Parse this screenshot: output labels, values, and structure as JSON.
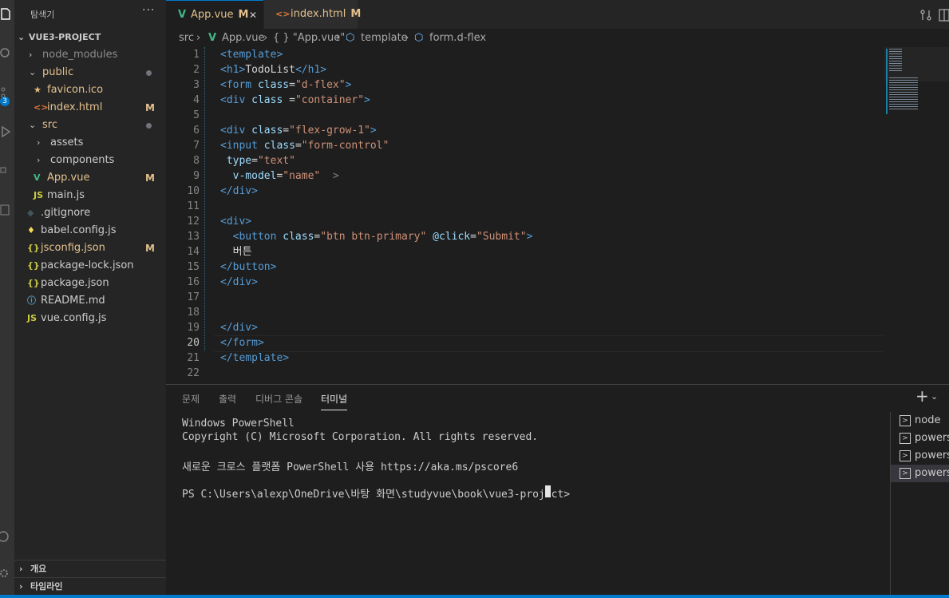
{
  "sidebar": {
    "title": "탐색기",
    "more": "···",
    "project": "VUE3-PROJECT",
    "items": [
      {
        "label": "node_modules",
        "type": "folder",
        "state": "collapsed",
        "color": "#8c8c8c"
      },
      {
        "label": "public",
        "type": "folder",
        "state": "expanded",
        "color": "#e2c08d",
        "dot": true
      },
      {
        "label": "favicon.ico",
        "type": "file",
        "icon": "★",
        "iconColor": "#e5c07b",
        "color": "#e2c08d"
      },
      {
        "label": "index.html",
        "type": "file",
        "icon": "<>",
        "iconColor": "#e37933",
        "color": "#e2c08d",
        "badge": "M"
      },
      {
        "label": "src",
        "type": "folder",
        "state": "expanded",
        "color": "#e2c08d",
        "dot": true
      },
      {
        "label": "assets",
        "type": "folder",
        "state": "collapsed",
        "color": "#cccccc"
      },
      {
        "label": "components",
        "type": "folder",
        "state": "collapsed",
        "color": "#cccccc"
      },
      {
        "label": "App.vue",
        "type": "file",
        "icon": "V",
        "iconColor": "#41b883",
        "color": "#e2c08d",
        "badge": "M"
      },
      {
        "label": "main.js",
        "type": "file",
        "icon": "JS",
        "iconColor": "#cbcb41",
        "color": "#cccccc"
      },
      {
        "label": ".gitignore",
        "type": "file",
        "icon": "◆",
        "iconColor": "#41535b",
        "color": "#cccccc"
      },
      {
        "label": "babel.config.js",
        "type": "file",
        "icon": "♦",
        "iconColor": "#f5da55",
        "color": "#cccccc"
      },
      {
        "label": "jsconfig.json",
        "type": "file",
        "icon": "{}",
        "iconColor": "#cbcb41",
        "color": "#e2c08d",
        "badge": "M"
      },
      {
        "label": "package-lock.json",
        "type": "file",
        "icon": "{}",
        "iconColor": "#cbcb41",
        "color": "#cccccc"
      },
      {
        "label": "package.json",
        "type": "file",
        "icon": "{}",
        "iconColor": "#cbcb41",
        "color": "#cccccc"
      },
      {
        "label": "README.md",
        "type": "file",
        "icon": "ⓘ",
        "iconColor": "#519aba",
        "color": "#cccccc"
      },
      {
        "label": "vue.config.js",
        "type": "file",
        "icon": "JS",
        "iconColor": "#cbcb41",
        "color": "#cccccc"
      }
    ],
    "outline_label": "개요",
    "timeline_label": "타임라인"
  },
  "activity": {
    "badge": "3"
  },
  "tabs": [
    {
      "label": "App.vue",
      "modified": "M",
      "active": true,
      "close": "✕",
      "icon": "V",
      "iconColor": "#41b883"
    },
    {
      "label": "index.html",
      "modified": "M",
      "active": false,
      "icon": "<>",
      "iconColor": "#e37933"
    }
  ],
  "breadcrumb": [
    "src",
    "App.vue",
    "{ } \"App.vue\"",
    "template",
    "form.d-flex"
  ],
  "editor": {
    "current_line": 20,
    "lines": [
      [
        [
          "t",
          "<template>"
        ]
      ],
      [
        [
          "t",
          "<h1>"
        ],
        [
          "w",
          "TodoList"
        ],
        [
          "t",
          "</h1>"
        ]
      ],
      [
        [
          "t",
          "<form "
        ],
        [
          "a",
          "class"
        ],
        [
          "w",
          "="
        ],
        [
          "s",
          "\"d-flex\""
        ],
        [
          "t",
          ">"
        ]
      ],
      [
        [
          "t",
          "<div "
        ],
        [
          "a",
          "class"
        ],
        [
          "w",
          " ="
        ],
        [
          "s",
          "\"container\""
        ],
        [
          "t",
          ">"
        ]
      ],
      [],
      [
        [
          "t",
          "<div "
        ],
        [
          "a",
          "class"
        ],
        [
          "w",
          "="
        ],
        [
          "s",
          "\"flex-grow-1\""
        ],
        [
          "t",
          ">"
        ]
      ],
      [
        [
          "t",
          "<input "
        ],
        [
          "a",
          "class"
        ],
        [
          "w",
          "="
        ],
        [
          "s",
          "\"form-control\""
        ]
      ],
      [
        [
          "w",
          " "
        ],
        [
          "a",
          "type"
        ],
        [
          "w",
          "="
        ],
        [
          "s",
          "\"text\""
        ]
      ],
      [
        [
          "w",
          "  "
        ],
        [
          "a",
          "v-model"
        ],
        [
          "w",
          "="
        ],
        [
          "s",
          "\"name\""
        ],
        [
          "w",
          "  "
        ],
        [
          "p",
          ">"
        ]
      ],
      [
        [
          "t",
          "</div>"
        ]
      ],
      [],
      [
        [
          "t",
          "<div>"
        ]
      ],
      [
        [
          "w",
          "  "
        ],
        [
          "t",
          "<button "
        ],
        [
          "a",
          "class"
        ],
        [
          "w",
          "="
        ],
        [
          "s",
          "\"btn btn-primary\""
        ],
        [
          "w",
          " "
        ],
        [
          "a",
          "@click"
        ],
        [
          "w",
          "="
        ],
        [
          "s",
          "\"Submit\""
        ],
        [
          "t",
          ">"
        ]
      ],
      [
        [
          "w",
          "  버튼"
        ]
      ],
      [
        [
          "t",
          "</button>"
        ]
      ],
      [
        [
          "t",
          "</div>"
        ]
      ],
      [],
      [],
      [
        [
          "t",
          "</div>"
        ]
      ],
      [
        [
          "t",
          "</form>"
        ]
      ],
      [
        [
          "t",
          "</template>"
        ]
      ],
      []
    ]
  },
  "panel": {
    "tabs": [
      "문제",
      "출력",
      "디버그 콘솔",
      "터미널"
    ],
    "active_tab": "터미널",
    "add": "+",
    "terminal_lines": [
      "Windows PowerShell",
      "Copyright (C) Microsoft Corporation. All rights reserved.",
      "",
      "새로운 크로스 플랫폼 PowerShell 사용 https://aka.ms/pscore6",
      "",
      "PS C:\\Users\\alexp\\OneDrive\\바탕 화면\\studyvue\\book\\vue3-project> "
    ],
    "terminals": [
      "node",
      "powershell",
      "powershell",
      "powershell"
    ],
    "active_terminal": 3
  },
  "colors": {
    "accent": "#007acc",
    "modified": "#e2c08d"
  }
}
